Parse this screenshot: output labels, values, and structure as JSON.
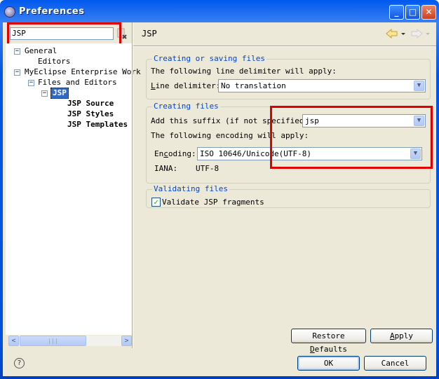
{
  "window": {
    "title": "Preferences",
    "minimize": "_",
    "maximize": "□",
    "close": "✕"
  },
  "filter": {
    "value": "JSP"
  },
  "tree": [
    {
      "label": "General",
      "expanded": true
    },
    {
      "label": "Editors"
    },
    {
      "label": "MyEclipse Enterprise Work",
      "expanded": true
    },
    {
      "label": "Files and Editors",
      "expanded": true
    },
    {
      "label": "JSP",
      "selected": true,
      "expanded": true
    },
    {
      "label": "JSP Source"
    },
    {
      "label": "JSP Styles"
    },
    {
      "label": "JSP Templates"
    }
  ],
  "page": {
    "title": "JSP"
  },
  "groups": {
    "saving": {
      "title": "Creating or saving files",
      "text": "The following line delimiter will apply:",
      "delim_label_u": "L",
      "delim_label_rest": "ine delimiter:",
      "delim_value": "No translation"
    },
    "creating": {
      "title": "Creating files",
      "suffix_label": "Add this suffix (if not specified):",
      "suffix_value": "jsp",
      "encoding_text": "The following encoding will apply:",
      "enc_label_a": "En",
      "enc_label_u": "c",
      "enc_label_b": "oding:",
      "enc_value": "ISO 10646/Unicode(UTF-8)",
      "iana_label": "IANA:",
      "iana_value": "UTF-8"
    },
    "validating": {
      "title": "Validating files",
      "checkbox_label": "Validate JSP fragments",
      "checked": true
    }
  },
  "buttons": {
    "restore_a": "Restore ",
    "restore_u": "D",
    "restore_b": "efaults",
    "apply_u": "A",
    "apply_b": "pply",
    "ok": "OK",
    "cancel": "Cancel"
  },
  "colors": {
    "highlight": "#e00000",
    "group_title": "#0046d5",
    "selection": "#316ac5"
  }
}
